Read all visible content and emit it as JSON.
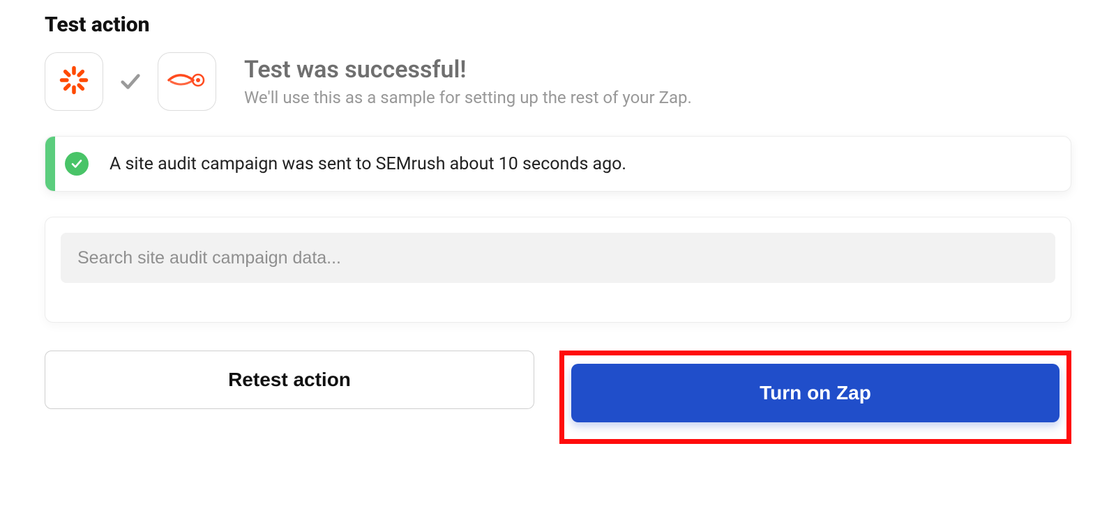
{
  "section": {
    "title": "Test action"
  },
  "status": {
    "apps": {
      "left_icon": "zapier-icon",
      "right_icon": "semrush-icon"
    },
    "title": "Test was successful!",
    "subtitle": "We'll use this as a sample for setting up the rest of your Zap."
  },
  "result": {
    "message": "A site audit campaign was sent to SEMrush about 10 seconds ago."
  },
  "search": {
    "placeholder": "Search site audit campaign data..."
  },
  "buttons": {
    "retest": "Retest action",
    "turn_on": "Turn on Zap"
  },
  "highlight": {
    "target": "turn-on-zap-button",
    "color": "#ff0b0b"
  }
}
